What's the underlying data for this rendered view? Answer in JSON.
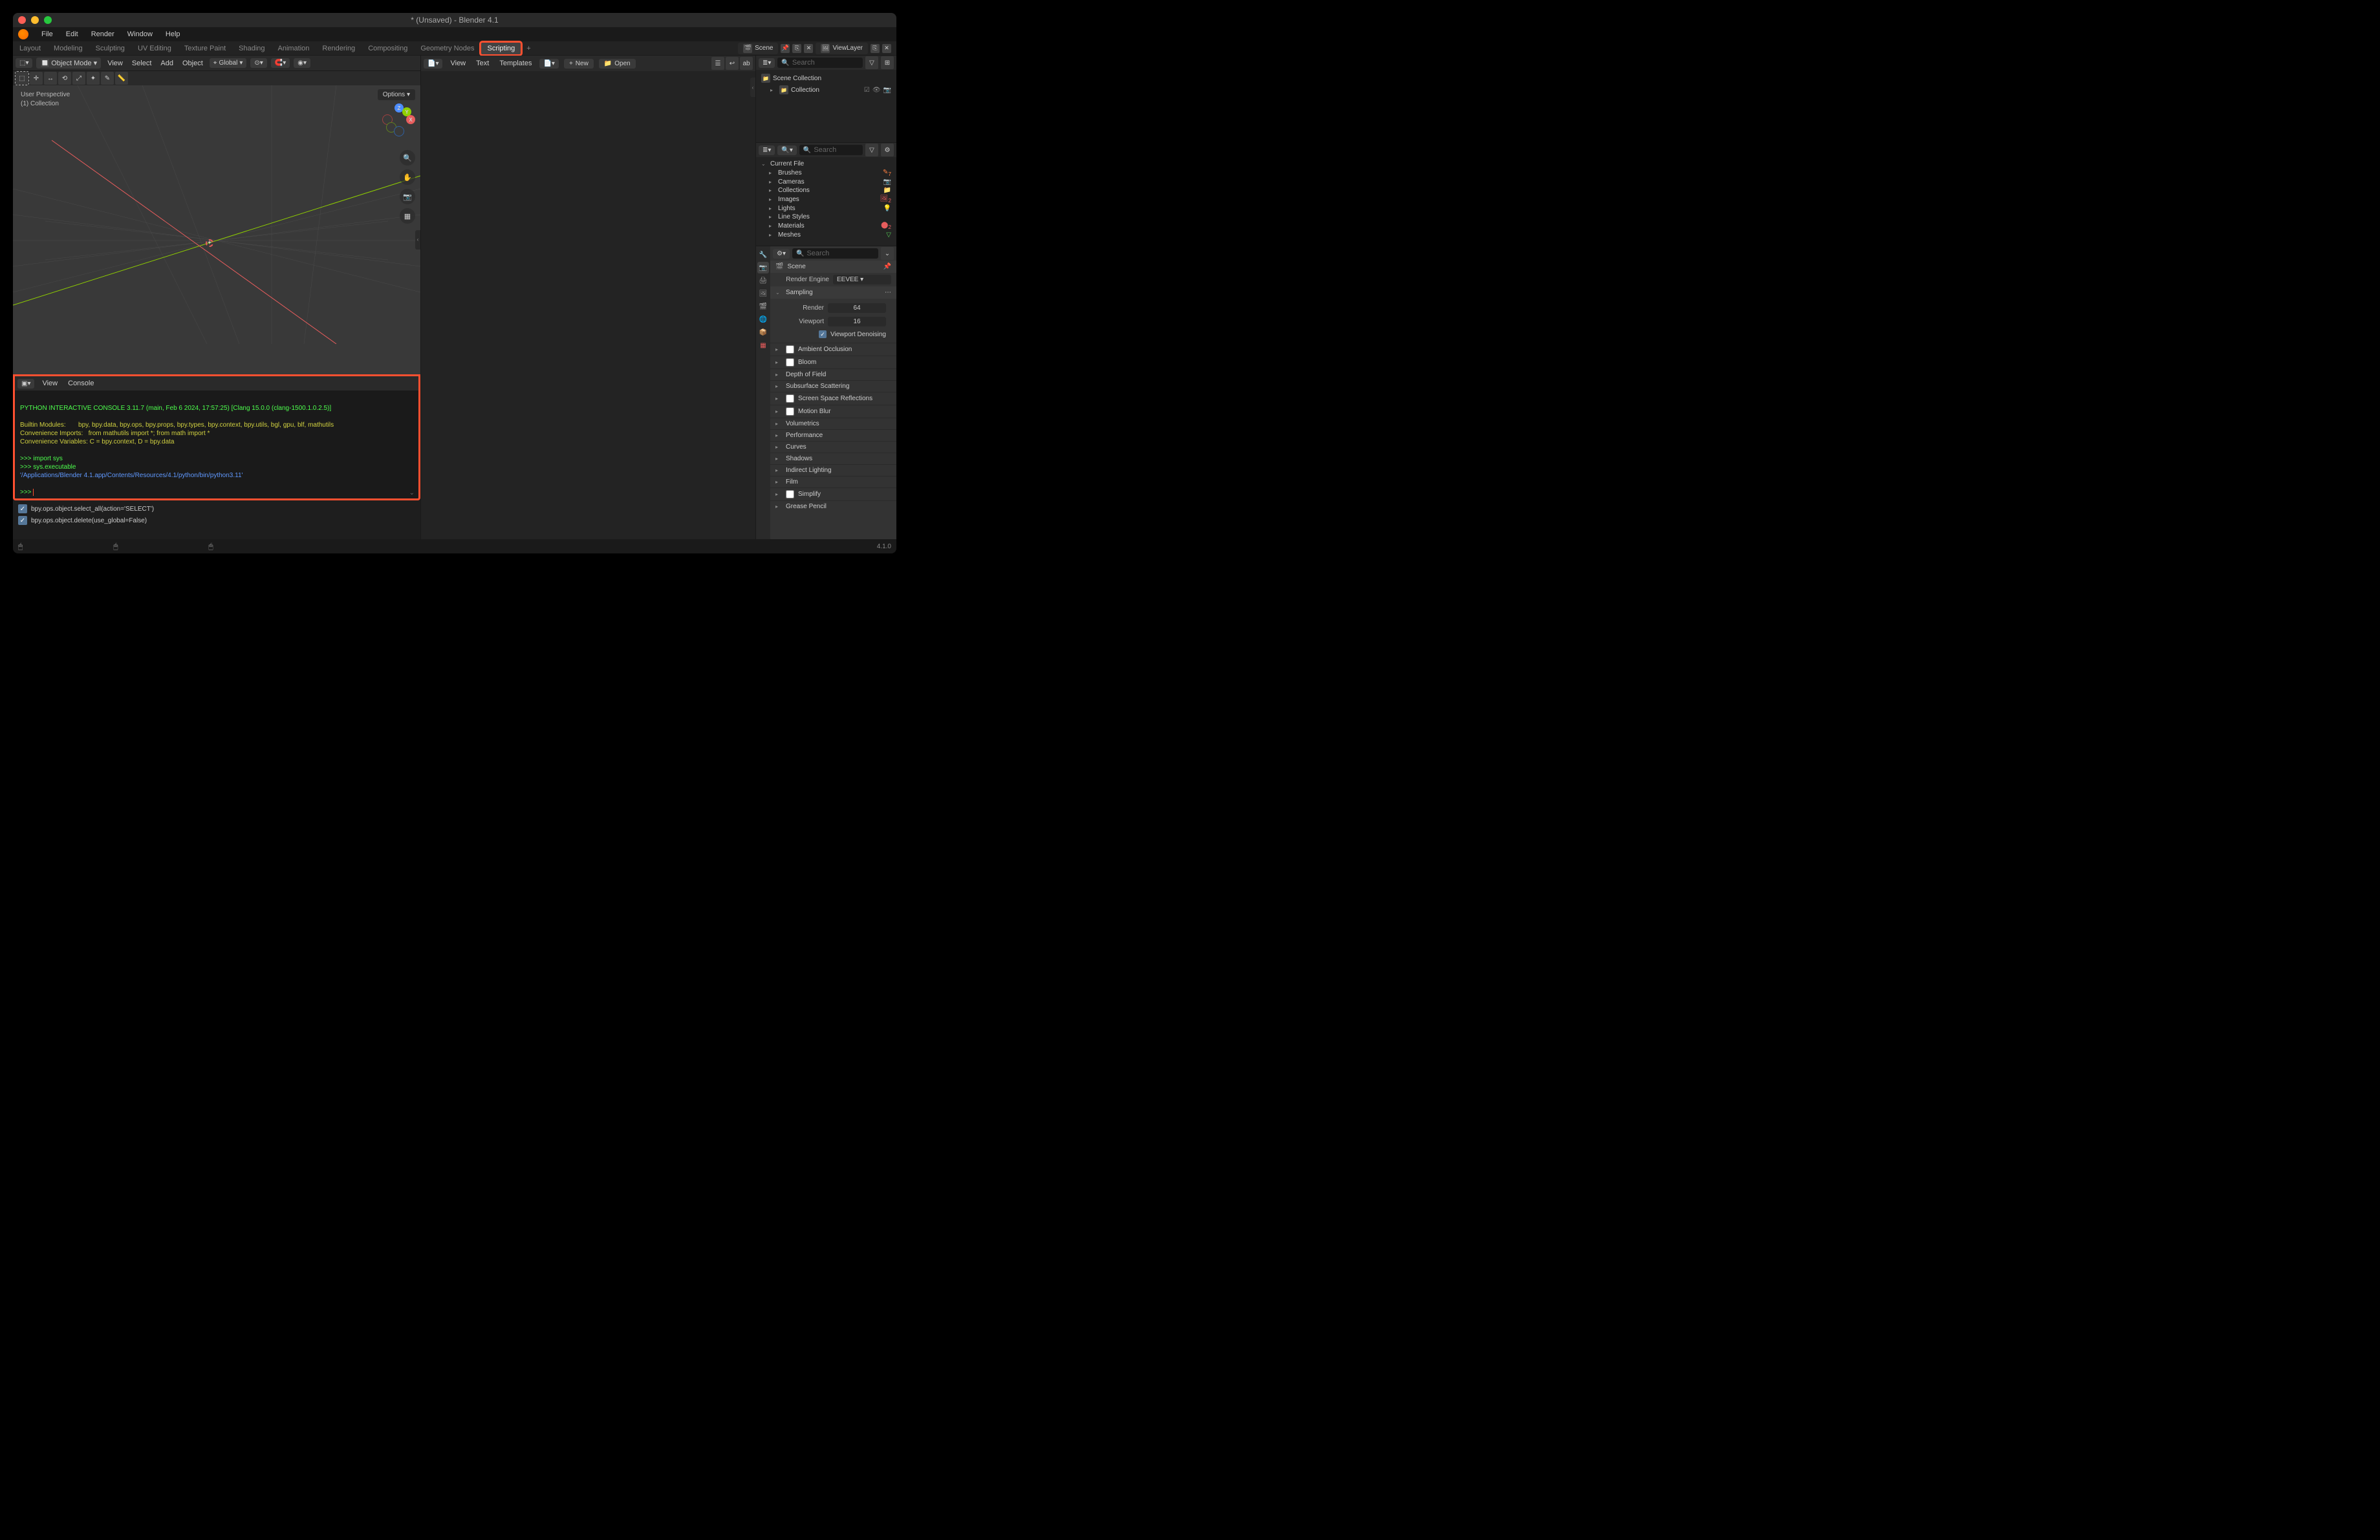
{
  "window": {
    "title": "* (Unsaved) - Blender 4.1"
  },
  "menubar": [
    "File",
    "Edit",
    "Render",
    "Window",
    "Help"
  ],
  "workspace_tabs": [
    "Layout",
    "Modeling",
    "Sculpting",
    "UV Editing",
    "Texture Paint",
    "Shading",
    "Animation",
    "Rendering",
    "Compositing",
    "Geometry Nodes",
    "Scripting"
  ],
  "active_workspace": "Scripting",
  "scene_selector": {
    "label": "Scene"
  },
  "viewlayer_selector": {
    "label": "ViewLayer"
  },
  "viewport_header": {
    "mode": "Object Mode",
    "menus": [
      "View",
      "Select",
      "Add",
      "Object"
    ],
    "orientation": "Global"
  },
  "viewport": {
    "label_line1": "User Perspective",
    "label_line2": "(1) Collection",
    "options_btn": "Options"
  },
  "console": {
    "menus": [
      "View",
      "Console"
    ],
    "banner": "PYTHON INTERACTIVE CONSOLE 3.11.7 (main, Feb  6 2024, 17:57:25) [Clang 15.0.0 (clang-1500.1.0.2.5)]",
    "builtin_label": "Builtin Modules:",
    "builtin_val": "bpy, bpy.data, bpy.ops, bpy.props, bpy.types, bpy.context, bpy.utils, bgl, gpu, blf, mathutils",
    "convi_label": "Convenience Imports:",
    "convi_val": "from mathutils import *; from math import *",
    "convv_label": "Convenience Variables:",
    "convv_val": "C = bpy.context, D = bpy.data",
    "history": [
      ">>> import sys",
      ">>> sys.executable"
    ],
    "output": "'/Applications/Blender 4.1.app/Contents/Resources/4.1/python/bin/python3.11'",
    "prompt": ">>> "
  },
  "info_panel": {
    "line1": "bpy.ops.object.select_all(action='SELECT')",
    "line2": "bpy.ops.object.delete(use_global=False)"
  },
  "text_editor": {
    "menus": [
      "View",
      "Text",
      "Templates"
    ],
    "new_label": "New",
    "open_label": "Open"
  },
  "outliner": {
    "search_placeholder": "Search",
    "root": "Scene Collection",
    "item": "Collection"
  },
  "library": {
    "search_placeholder": "Search",
    "current": "Current File",
    "categories": [
      {
        "name": "Brushes",
        "badge": "7"
      },
      {
        "name": "Cameras"
      },
      {
        "name": "Collections"
      },
      {
        "name": "Images",
        "badge": "2"
      },
      {
        "name": "Lights"
      },
      {
        "name": "Line Styles"
      },
      {
        "name": "Materials",
        "badge": "2"
      },
      {
        "name": "Meshes"
      }
    ]
  },
  "properties": {
    "search_placeholder": "Search",
    "scene_label": "Scene",
    "render_engine_label": "Render Engine",
    "render_engine_val": "EEVEE",
    "sampling": {
      "header": "Sampling",
      "render_label": "Render",
      "render_val": "64",
      "viewport_label": "Viewport",
      "viewport_val": "16",
      "denoise_label": "Viewport Denoising"
    },
    "panels": [
      "Ambient Occlusion",
      "Bloom",
      "Depth of Field",
      "Subsurface Scattering",
      "Screen Space Reflections",
      "Motion Blur",
      "Volumetrics",
      "Performance",
      "Curves",
      "Shadows",
      "Indirect Lighting",
      "Film",
      "Simplify",
      "Grease Pencil"
    ]
  },
  "statusbar": {
    "version": "4.1.0"
  }
}
